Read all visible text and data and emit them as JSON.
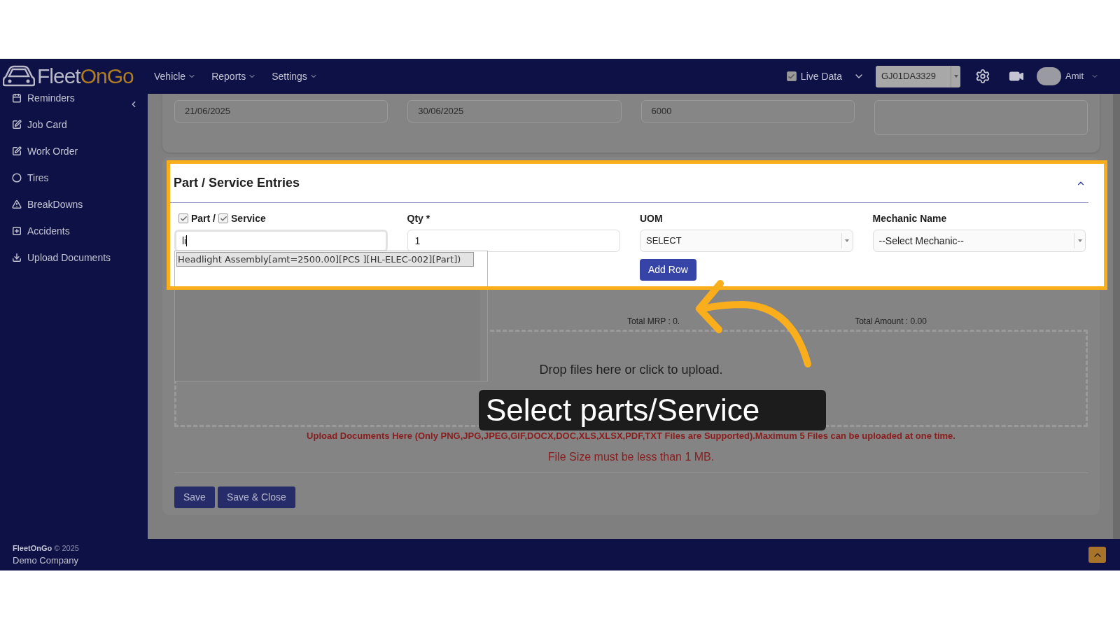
{
  "navbar": {
    "logo": {
      "first": "Fleet",
      "second": "OnGo"
    },
    "menus": [
      "Vehicle",
      "Reports",
      "Settings"
    ],
    "live_data": {
      "label": "Live Data",
      "checked": true
    },
    "vehicle": "GJ01DA3329",
    "user": "Amit"
  },
  "sidebar": {
    "items": [
      {
        "label": "Reminders",
        "kind": "calendar"
      },
      {
        "label": "Job Card",
        "kind": "edit"
      },
      {
        "label": "Work Order",
        "kind": "edit"
      },
      {
        "label": "Tires",
        "kind": "circle"
      },
      {
        "label": "BreakDowns",
        "kind": "warning"
      },
      {
        "label": "Accidents",
        "kind": "plus"
      },
      {
        "label": "Upload Documents",
        "kind": "download"
      }
    ]
  },
  "top_fields": {
    "values": [
      "21/06/2025",
      "30/06/2025",
      "6000"
    ]
  },
  "section": {
    "title": "Part / Service Entries",
    "part": {
      "label": "Part /",
      "checked": true
    },
    "service": {
      "label": "Service",
      "checked": true
    },
    "search_value": "li",
    "qty_label": "Qty *",
    "qty": "1",
    "uom_label": "UOM",
    "uom": "SELECT",
    "mechanic_label": "Mechanic Name",
    "mechanic": "--Select Mechanic--",
    "add_row": "Add Row",
    "suggestions": [
      {
        "text": "Headlight Assembly[amt=2500.00][PCS ][HL-ELEC-002][Part])",
        "selected": true
      }
    ]
  },
  "totals": {
    "mrp": "Total MRP : 0.",
    "amount": "Total Amount : 0.00"
  },
  "upload": {
    "dropzone": "Drop files here or click to upload.",
    "note": "Upload Documents Here (Only PNG,JPG,JPEG,GIF,DOCX,DOC,XLS,XLSX,PDF,TXT Files are Supported).Maximum 5 Files can be uploaded at one time.",
    "size_note": "File Size must be less than 1 MB."
  },
  "buttons": [
    "Save",
    "Save & Close"
  ],
  "footer": {
    "brand": "FleetOnGo",
    "year": "© 2025",
    "company": "Demo Company"
  },
  "caption": "Select parts/Service"
}
